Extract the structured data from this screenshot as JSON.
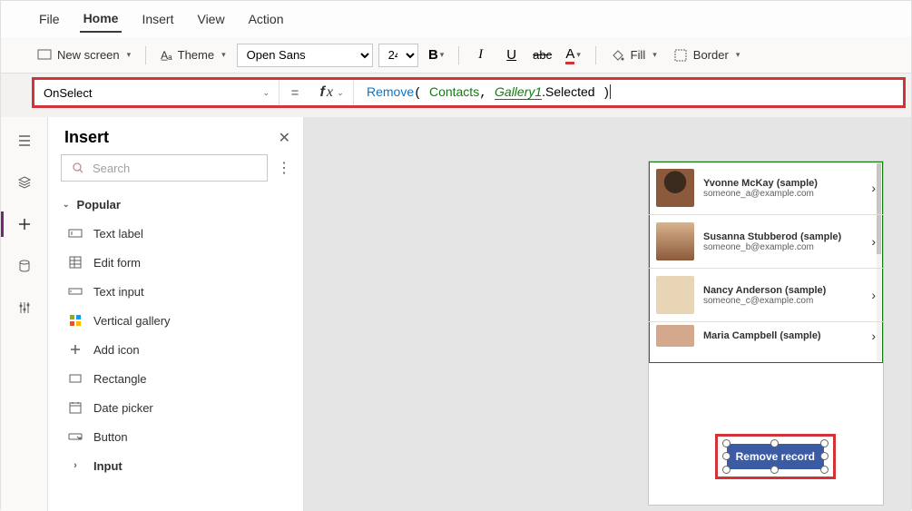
{
  "menu": {
    "file": "File",
    "home": "Home",
    "insert": "Insert",
    "view": "View",
    "action": "Action"
  },
  "toolbar": {
    "newscreen": "New screen",
    "theme": "Theme",
    "font": "Open Sans",
    "fontsize": "24",
    "fill": "Fill",
    "border": "Border"
  },
  "formula": {
    "prop": "OnSelect",
    "fn": "Remove",
    "ds": "Contacts",
    "ref": "Gallery1",
    "refprop": ".Selected"
  },
  "panel": {
    "title": "Insert",
    "search_ph": "Search",
    "cat_popular": "Popular",
    "items": {
      "textlabel": "Text label",
      "editform": "Edit form",
      "textinput": "Text input",
      "vgallery": "Vertical gallery",
      "addicon": "Add icon",
      "rectangle": "Rectangle",
      "datepicker": "Date picker",
      "button": "Button",
      "input": "Input"
    }
  },
  "gallery": {
    "rows": [
      {
        "name": "Yvonne McKay (sample)",
        "mail": "someone_a@example.com"
      },
      {
        "name": "Susanna Stubberod (sample)",
        "mail": "someone_b@example.com"
      },
      {
        "name": "Nancy Anderson (sample)",
        "mail": "someone_c@example.com"
      },
      {
        "name": "Maria Campbell (sample)",
        "mail": ""
      }
    ]
  },
  "button": {
    "label": "Remove record"
  }
}
